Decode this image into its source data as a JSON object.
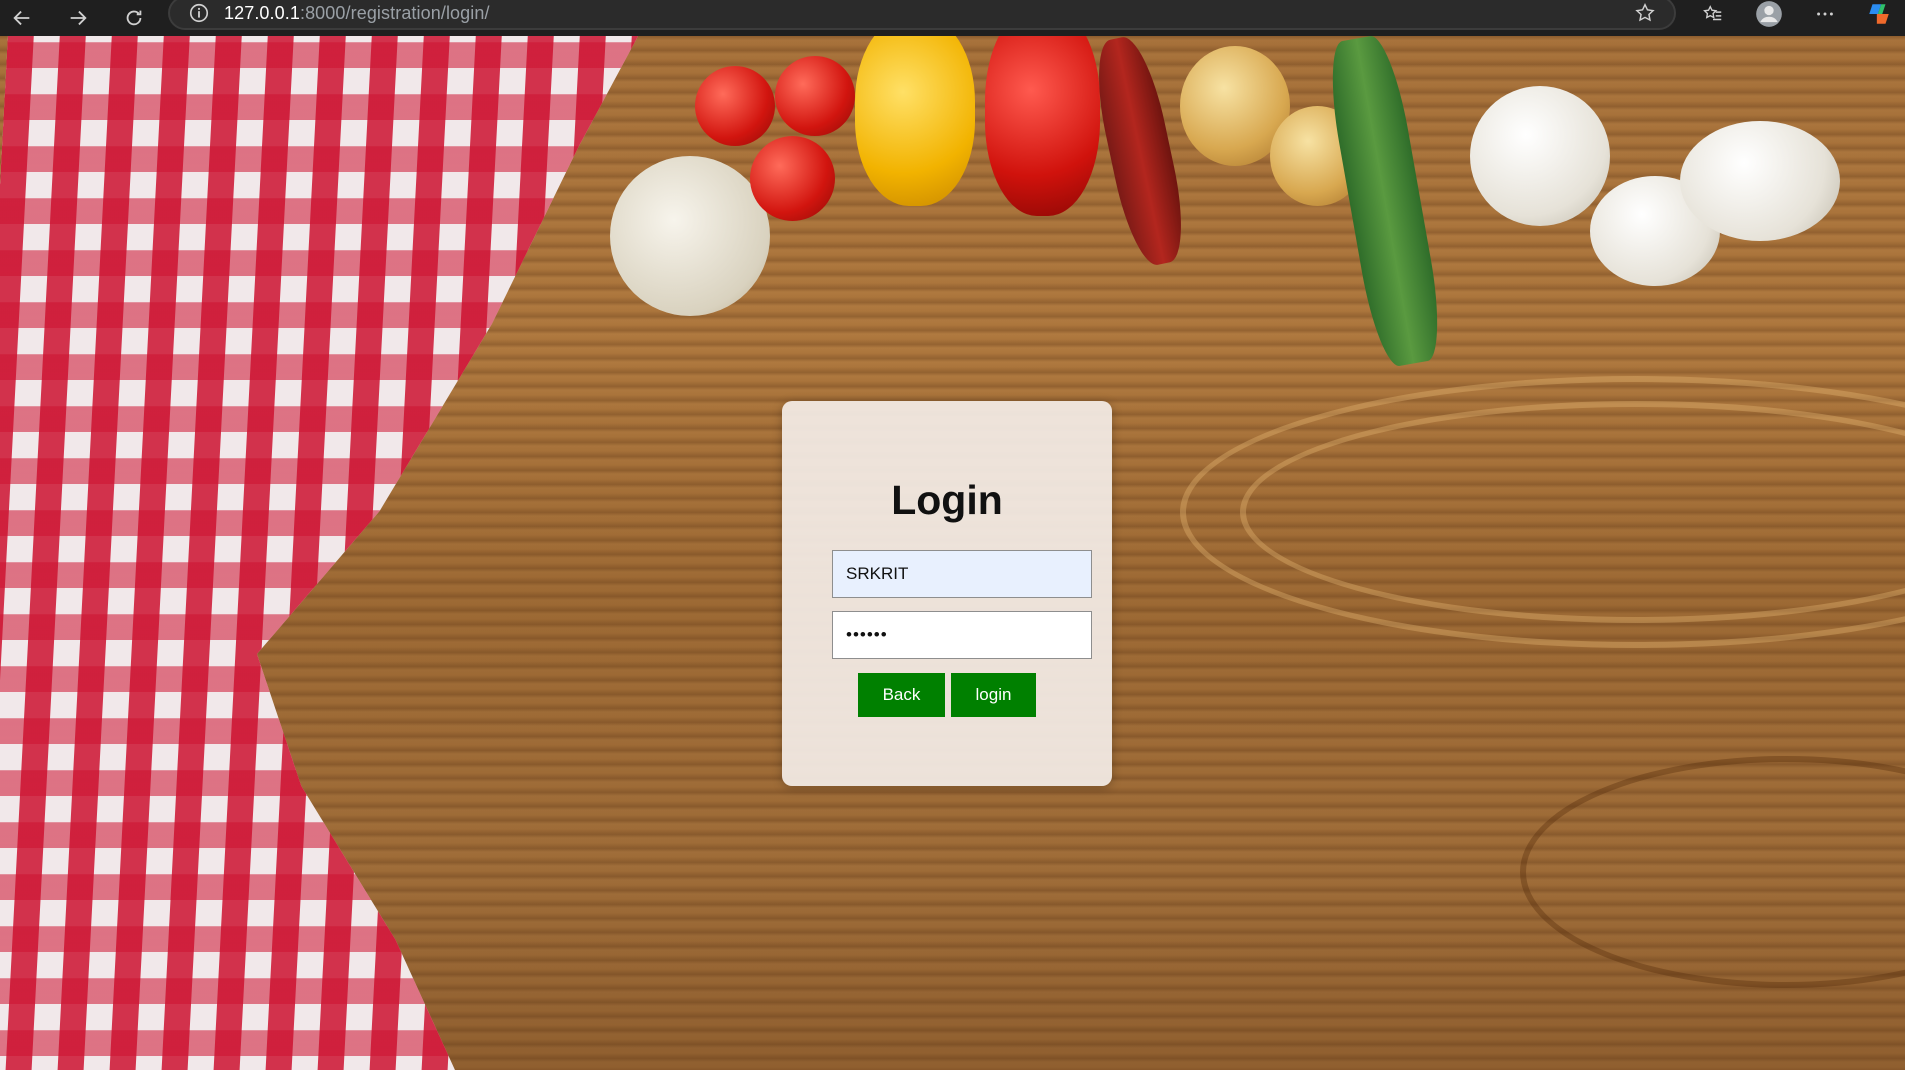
{
  "browser": {
    "url_host": "127.0.0.1",
    "url_rest": ":8000/registration/login/",
    "icons": {
      "back": "arrow-left-icon",
      "forward": "arrow-right-icon",
      "reload": "reload-icon",
      "site_info": "info-icon",
      "favorite": "star-icon",
      "favorites": "favorites-list-icon",
      "profile": "profile-icon",
      "menu": "more-icon",
      "copilot": "copilot-icon"
    }
  },
  "login_form": {
    "title": "Login",
    "username_value": "SRKRIT",
    "password_value": "••••••",
    "back_label": "Back",
    "login_label": "login",
    "button_color": "#008000"
  }
}
